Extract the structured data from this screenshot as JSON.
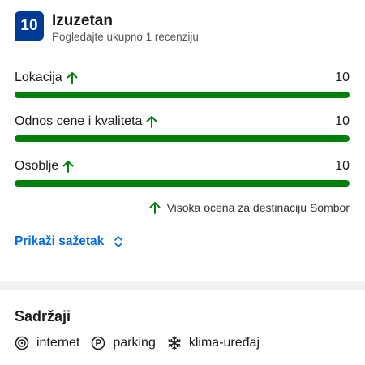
{
  "score": {
    "value": "10",
    "title": "Izuzetan",
    "subtitle": "Pogledajte ukupno 1 recenziju"
  },
  "categories": [
    {
      "label": "Lokacija",
      "value": "10",
      "fill": 1.0
    },
    {
      "label": "Odnos cene i kvaliteta",
      "value": "10",
      "fill": 1.0
    },
    {
      "label": "Osoblje",
      "value": "10",
      "fill": 1.0
    }
  ],
  "highlight": {
    "text": "Visoka ocena za destinaciju Sombor",
    "icon": "arrow-up-icon"
  },
  "summary_link": {
    "label": "Prikaži sažetak",
    "icon": "chevron-up-down-icon"
  },
  "amenities": {
    "title": "Sadržaji",
    "items": [
      {
        "label": "internet",
        "icon": "wifi-icon"
      },
      {
        "label": "parking",
        "icon": "parking-icon"
      },
      {
        "label": "klima-uređaj",
        "icon": "snowflake-icon"
      }
    ]
  },
  "colors": {
    "brand": "#003b95",
    "link": "#006ce4",
    "good": "#008009",
    "track": "#e7e7e7"
  }
}
